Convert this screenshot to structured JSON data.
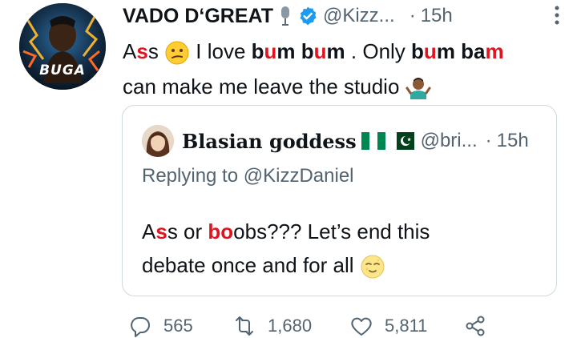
{
  "tweet": {
    "author_name": "VADO D‘GREAT",
    "handle": "@Kizz...",
    "separator": "·",
    "time": "15h",
    "avatar_text": "BUGA",
    "text": {
      "p1": "A",
      "c1": "s",
      "p2": "s",
      "p3": " I love ",
      "w1a": "b",
      "c2": "u",
      "w1b": "m b",
      "c3": "u",
      "w1c": "m",
      "p4": " . Only ",
      "w2a": "b",
      "c4": "u",
      "w2b": "m ba",
      "c5": "m",
      "line2": "can make me leave the studio"
    }
  },
  "quote": {
    "author_name": "Blasian goddess",
    "handle": "@bri...",
    "separator": "·",
    "time": "15h",
    "replying_prefix": "Replying to ",
    "replying_handle": "@KizzDaniel",
    "text": {
      "a1": "A",
      "c1": "s",
      "a2": "s or ",
      "c2": "bo",
      "a3": "obs??? Let’s end this",
      "line2": "debate once and for all"
    }
  },
  "actions": {
    "replies": "565",
    "retweets": "1,680",
    "likes": "5,811"
  },
  "colors": {
    "text": "#0f1419",
    "secondary": "#536471",
    "verified": "#1d9bf0",
    "censor": "#e0141e",
    "border": "#cfd9de"
  }
}
